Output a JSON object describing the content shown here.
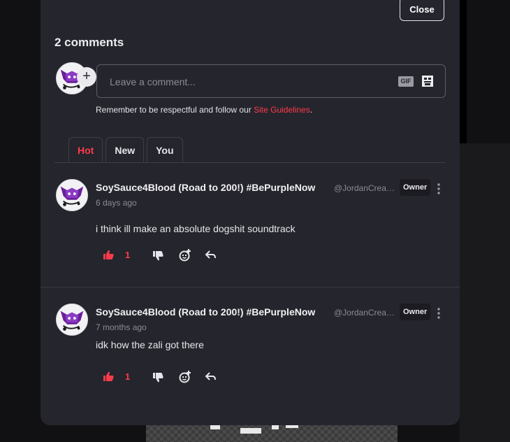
{
  "header": {
    "close_label": "Close",
    "comment_count": "2 comments"
  },
  "composer": {
    "placeholder": "Leave a comment...",
    "add_icon": "plus-icon",
    "gif_label": "GIF",
    "sticker_icon": "sticker-icon",
    "guidelines_prefix": "Remember to be respectful and follow our ",
    "guidelines_link": "Site Guidelines",
    "guidelines_suffix": "."
  },
  "tabs": [
    {
      "label": "Hot",
      "active": true
    },
    {
      "label": "New",
      "active": false
    },
    {
      "label": "You",
      "active": false
    }
  ],
  "comments": [
    {
      "author": "SoySauce4Blood (Road to 200!) #BePurpleNow",
      "handle": "@JordanCreations",
      "badge": "Owner",
      "time": "6 days ago",
      "text": "i think ill make an absolute dogshit soundtrack",
      "likes": "1"
    },
    {
      "author": "SoySauce4Blood (Road to 200!) #BePurpleNow",
      "handle": "@JordanCreations",
      "badge": "Owner",
      "time": "7 months ago",
      "text": "idk how the zali got there",
      "likes": "1"
    }
  ],
  "colors": {
    "accent": "#ff3b4a",
    "panel": "#25252d",
    "background": "#111113",
    "muted_text": "#8b8b93"
  },
  "icons": [
    "thumbs-up-icon",
    "thumbs-down-icon",
    "add-reaction-icon",
    "reply-icon",
    "more-vertical-icon"
  ]
}
